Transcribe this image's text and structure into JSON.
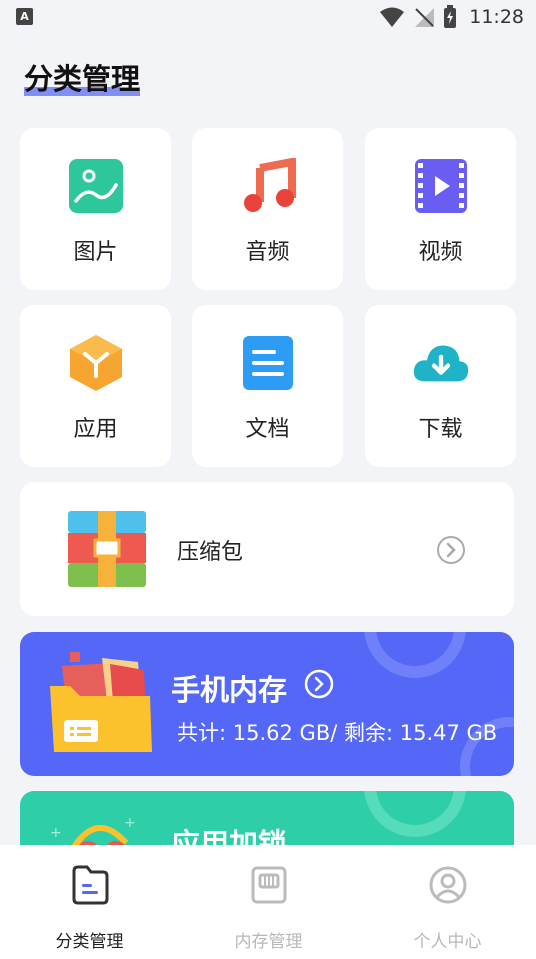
{
  "status_bar": {
    "time": "11:28"
  },
  "page_title": "分类管理",
  "categories": [
    {
      "label": "图片",
      "icon": "image-icon"
    },
    {
      "label": "音频",
      "icon": "music-icon"
    },
    {
      "label": "视频",
      "icon": "video-icon"
    },
    {
      "label": "应用",
      "icon": "app-icon"
    },
    {
      "label": "文档",
      "icon": "document-icon"
    },
    {
      "label": "下载",
      "icon": "cloud-download-icon"
    }
  ],
  "archive": {
    "label": "压缩包",
    "icon": "archive-icon"
  },
  "storage": {
    "title": "手机内存",
    "info": "共计: 15.62 GB/ 剩余: 15.47 GB"
  },
  "speedup": {
    "title": "应用加锁"
  },
  "tabs": [
    {
      "label": "分类管理",
      "active": true
    },
    {
      "label": "内存管理",
      "active": false
    },
    {
      "label": "个人中心",
      "active": false
    }
  ],
  "colors": {
    "accent": "#5467f6",
    "green_card": "#2ecfa8",
    "background": "#f3f4f8"
  }
}
